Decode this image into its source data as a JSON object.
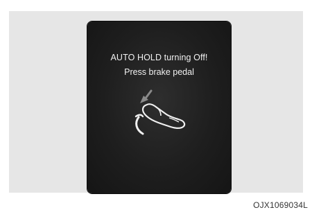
{
  "display": {
    "message_line1": "AUTO HOLD turning Off!",
    "message_line2": "Press brake pedal",
    "icon": "foot-pressing-brake-pedal-icon",
    "text_color": "#f2f2f2",
    "background_color": "#1e1e1e"
  },
  "figure": {
    "reference_code": "OJX1069034L"
  }
}
